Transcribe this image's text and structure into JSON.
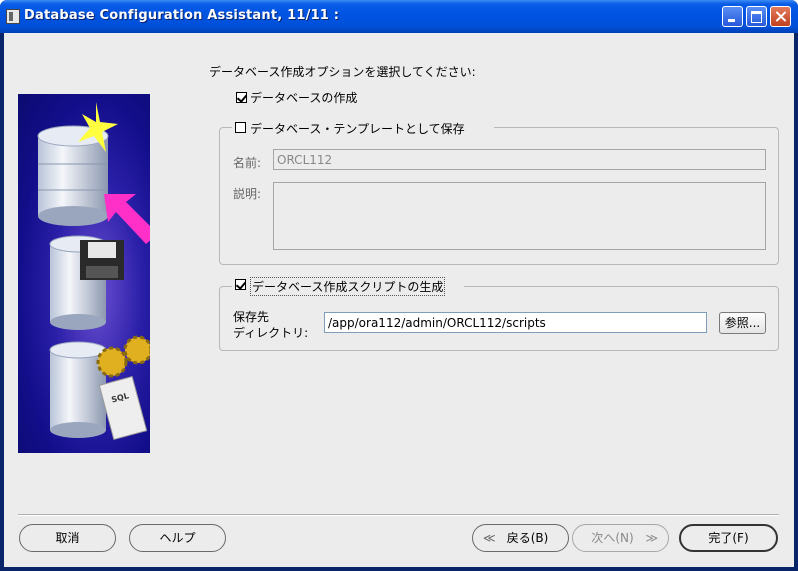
{
  "window": {
    "title": "Database Configuration Assistant, 11/11 :"
  },
  "heading": "データベース作成オプションを選択してください:",
  "create_db": {
    "label": "データベースの作成",
    "checked": true
  },
  "template_group": {
    "label": "データベース・テンプレートとして保存",
    "checked": false,
    "name_label": "名前:",
    "name_value": "ORCL112",
    "desc_label": "説明:",
    "desc_value": ""
  },
  "scripts_group": {
    "label": "データベース作成スクリプトの生成",
    "checked": true,
    "dest_label_1": "保存先",
    "dest_label_2": "ディレクトリ:",
    "dest_value": "/app/ora112/admin/ORCL112/scripts",
    "browse_label": "参照..."
  },
  "footer": {
    "cancel": "取消",
    "help": "ヘルプ",
    "back": "戻る(B)",
    "next": "次へ(N)",
    "finish": "完了(F)"
  },
  "art": {
    "sql_label": "SQL"
  },
  "colors": {
    "titlebar": "#0054e3",
    "dialog_bg": "#ececec",
    "art_bg": "#1a148f"
  }
}
